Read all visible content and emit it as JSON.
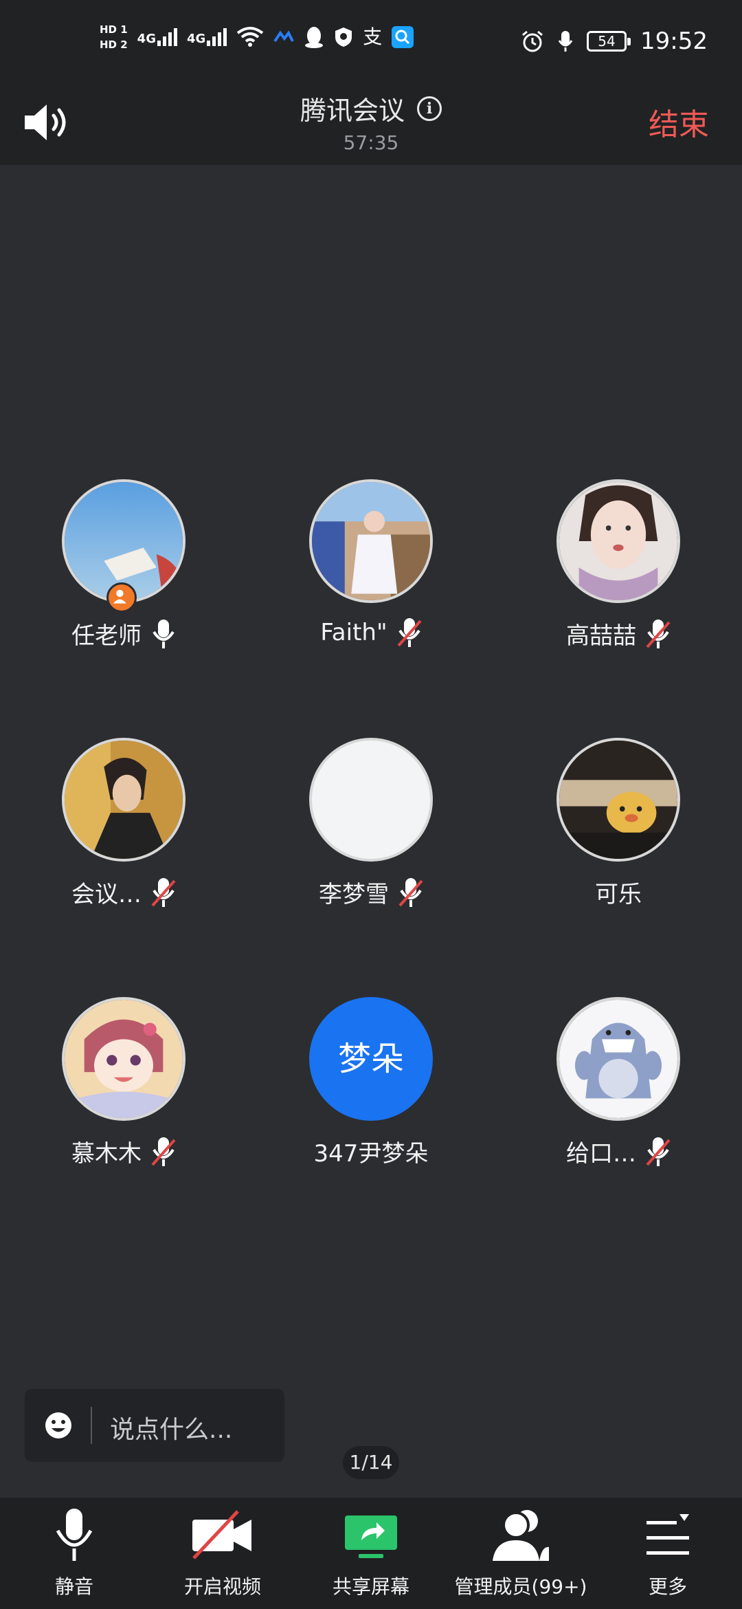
{
  "status_bar": {
    "hd1": "HD 1",
    "hd2": "HD 2",
    "net1": "4G",
    "net2": "4G",
    "battery": "54",
    "time": "19:52"
  },
  "header": {
    "title": "腾讯会议",
    "elapsed": "57:35",
    "end_label": "结束",
    "end_color": "#f05a55"
  },
  "participants": [
    {
      "name": "任老师",
      "mic": "on",
      "host": true
    },
    {
      "name": "Faith\"",
      "mic": "muted"
    },
    {
      "name": "高喆喆",
      "mic": "muted"
    },
    {
      "name": "会议…",
      "mic": "muted"
    },
    {
      "name": "李梦雪",
      "mic": "muted"
    },
    {
      "name": "可乐",
      "mic": "none"
    },
    {
      "name": "慕木木",
      "mic": "muted"
    },
    {
      "name": "347尹梦朵",
      "mic": "none",
      "avatar_text": "梦朵",
      "avatar_color": "#1a73f0"
    },
    {
      "name": "给口…",
      "mic": "muted"
    }
  ],
  "chat": {
    "placeholder": "说点什么..."
  },
  "pager": {
    "text": "1/14"
  },
  "toolbar": {
    "mute": "静音",
    "video": "开启视频",
    "share": "共享屏幕",
    "members": "管理成员(99+)",
    "more": "更多"
  },
  "colors": {
    "accent_green": "#2bc46b",
    "background": "#2b2d31"
  }
}
